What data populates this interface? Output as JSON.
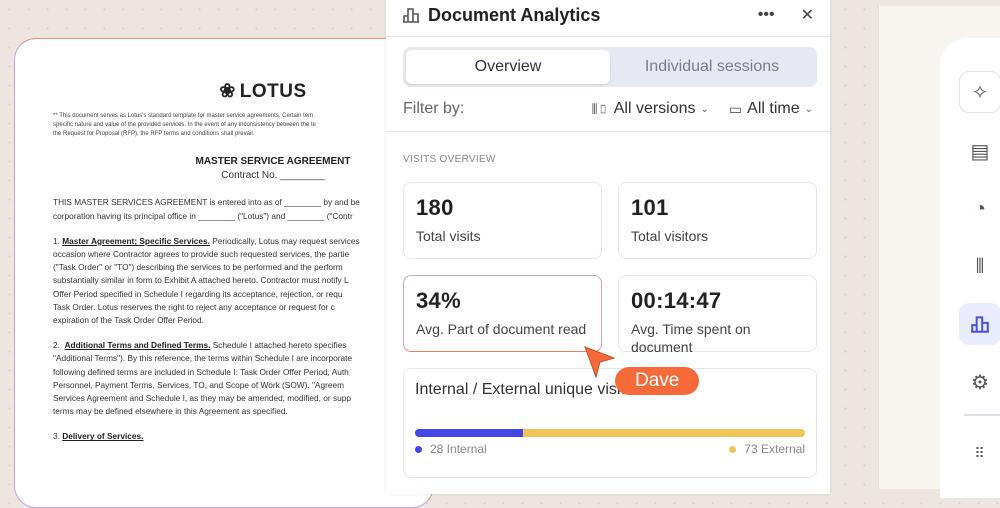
{
  "document": {
    "logo": "LOTUS",
    "note": [
      "** This document serves as Lotus's standard template for master service agreements. Certain tem",
      "specific nature and value of the provided services. In the event of any inconsistency between the te",
      "the Request for Proposal (RFP), the RFP terms and conditions shall prevail."
    ],
    "title": "MASTER SERVICE AGREEMENT",
    "contract": "Contract No. ________",
    "intro": [
      "THIS MASTER SERVICES AGREEMENT is entered into as of ________ by and be",
      "corporation having its principal office in ________ (\"Lotus\") and ________ (\"Contr"
    ],
    "s1_num": "1.",
    "s1_head": "Master Agreement; Specific Services.",
    "s1_first": " Periodically, Lotus may request services",
    "s1": [
      "occasion where Contractor agrees to provide such requested services, the partie",
      "(\"Task Order\" or \"TO\") describing the services to be performed and the perform",
      "substantially similar in form to Exhibit A attached hereto. Contractor must notify L",
      "Offer Period specified in Schedule I regarding its acceptance, rejection, or requ",
      "Task Order. Lotus reserves the right to reject any acceptance or request for c",
      "expiration of the Task Order Offer Period."
    ],
    "s2_num": "2.",
    "s2_head": "Additional Terms and Defined Terms.",
    "s2_first": " Schedule I attached hereto specifies",
    "s2": [
      "\"Additional Terms\"). By this reference, the terms within Schedule I are incorporate",
      "following defined terms are included in Schedule I: Task Order Offer Period, Auth",
      "Personnel, Payment Terms, Services, TO, and Scope of Work (SOW). \"Agreem",
      "Services Agreement and Schedule I, as they may be amended, modified, or supp",
      "terms may be defined elsewhere in this Agreement as specified."
    ],
    "s3_num": "3.",
    "s3_head": "Delivery of Services."
  },
  "panel": {
    "title": "Document Analytics",
    "more": "•••",
    "close": "✕",
    "tabs": [
      "Overview",
      "Individual sessions"
    ],
    "filter_label": "Filter by:",
    "versions": "All versions",
    "time": "All time",
    "section": "VISITS OVERVIEW",
    "cards": [
      {
        "value": "180",
        "label": "Total visits"
      },
      {
        "value": "101",
        "label": "Total visitors"
      },
      {
        "value": "34%",
        "label": "Avg. Part of document read"
      },
      {
        "value": "00:14:47",
        "label": "Avg. Time spent on document"
      }
    ],
    "split": {
      "title": "Internal / External unique visits",
      "internal": 28,
      "external": 73,
      "internal_label": "28 Internal",
      "external_label": "73 External",
      "internal_color": "#4447e6",
      "external_color": "#f1c458"
    }
  },
  "cursor": {
    "name": "Dave",
    "color": "#f66a3a"
  },
  "sidebar": [
    "sparkle-icon",
    "comment-icon",
    "history-icon",
    "versions-icon",
    "analytics-icon",
    "settings-icon",
    "apps-grid-icon"
  ]
}
